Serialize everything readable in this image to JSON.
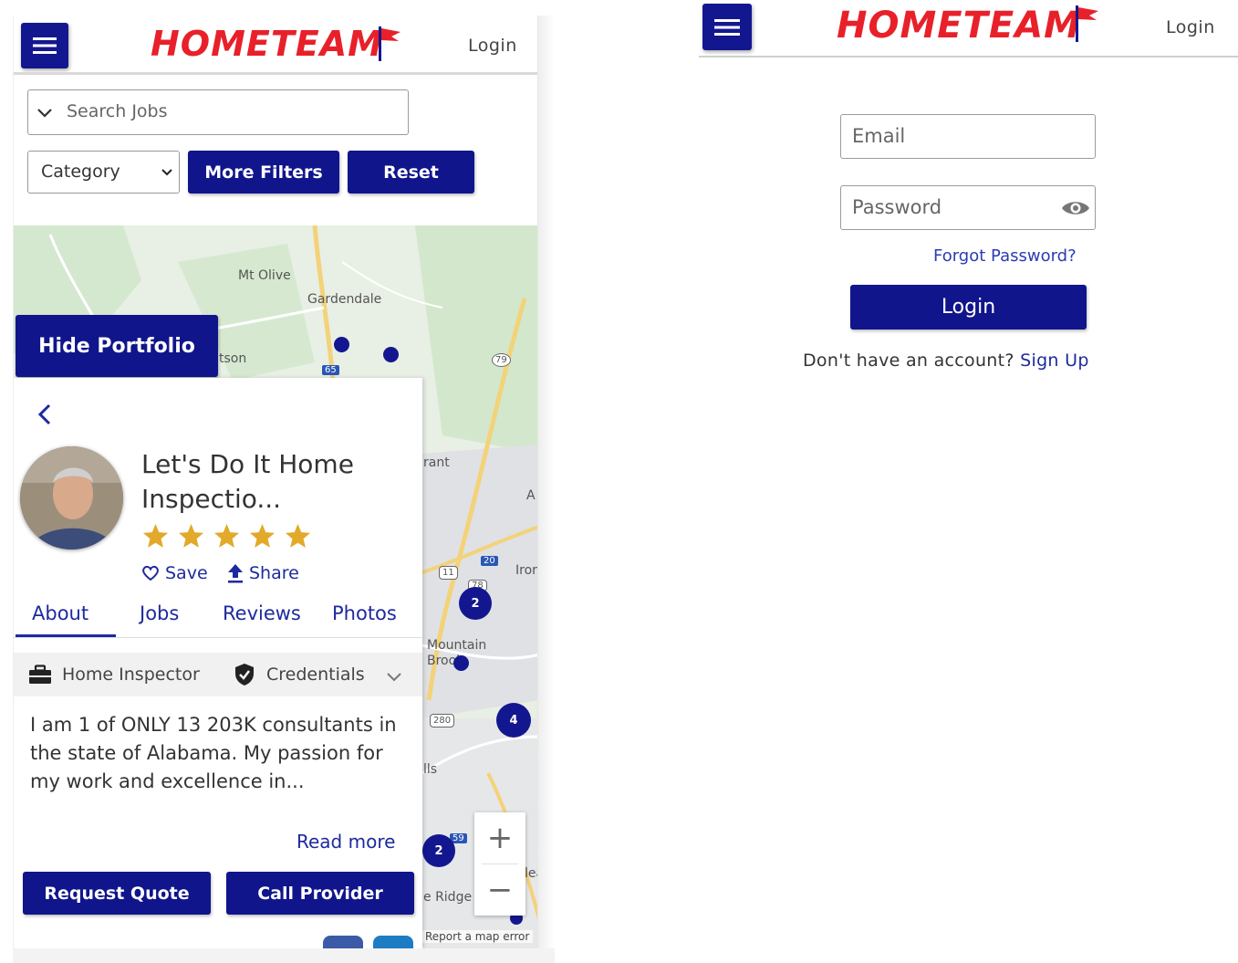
{
  "brand": {
    "name": "HOMETEAM"
  },
  "left": {
    "header": {
      "login_label": "Login"
    },
    "search": {
      "placeholder": "Search Jobs"
    },
    "filters": {
      "category": "Category",
      "more_filters": "More Filters",
      "reset": "Reset"
    },
    "portfolio_toggle": "Hide Portfolio",
    "map": {
      "labels": [
        "Mt Olive",
        "Gardendale",
        "tson",
        "rant",
        "Iror",
        "Mountain Brook",
        "lls",
        "e Ridge",
        "lea",
        "A"
      ],
      "highway_shields": [
        "65",
        "79",
        "20",
        "11",
        "78",
        "280",
        "59"
      ],
      "clusters": [
        "2",
        "4",
        "2"
      ],
      "zoom_in": "+",
      "zoom_out": "−",
      "footer": "Report a map error"
    },
    "provider": {
      "name": "Let's Do It Home Inspectio...",
      "rating": 5,
      "save": "Save",
      "share": "Share",
      "tabs": [
        "About",
        "Jobs",
        "Reviews",
        "Photos"
      ],
      "active_tab": "About",
      "profession": "Home Inspector",
      "credentials": "Credentials",
      "about": "I am 1 of ONLY 13 203K consultants in the state of Alabama. My passion for my work and excellence in...",
      "read_more": "Read more",
      "request_quote": "Request Quote",
      "call_provider": "Call Provider"
    }
  },
  "right": {
    "header": {
      "login_label": "Login"
    },
    "form": {
      "email_placeholder": "Email",
      "password_placeholder": "Password",
      "forgot": "Forgot Password?",
      "submit": "Login",
      "signup_prompt": "Don't have an account?",
      "signup_link": "Sign Up"
    }
  },
  "colors": {
    "primary": "#10158c",
    "brand_red": "#e8202a",
    "link": "#1d2a9e",
    "star": "#e2a92a"
  }
}
